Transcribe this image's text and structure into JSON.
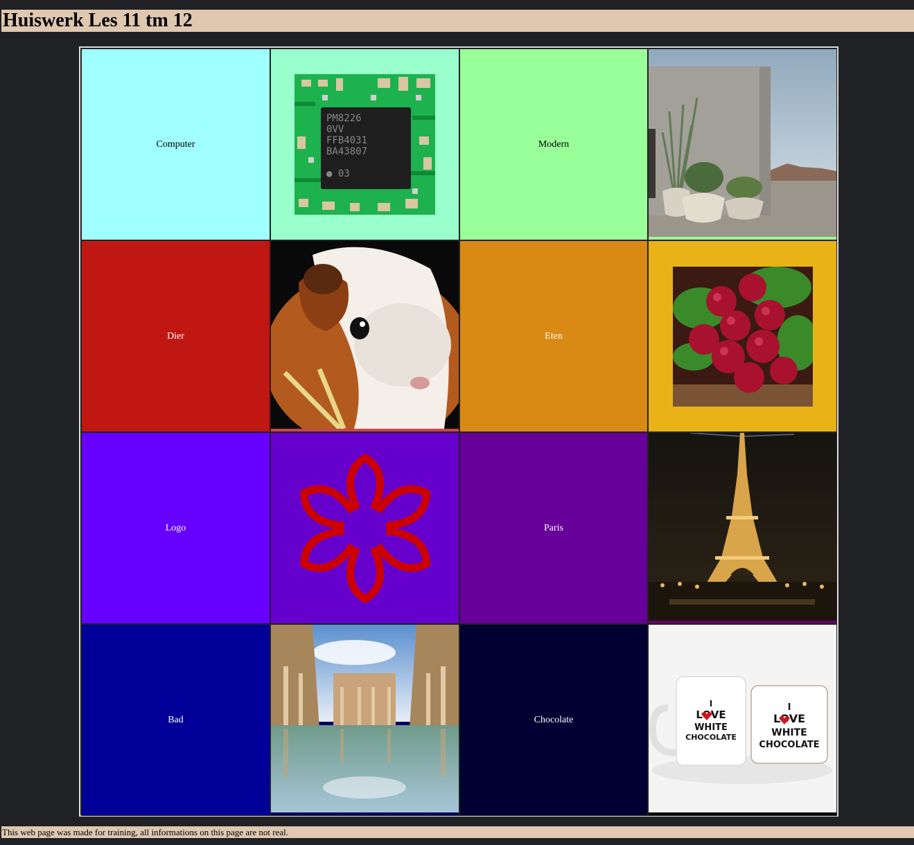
{
  "page_title": "Huiswerk Les 11 tm 12",
  "footer_text": "This web page was made for training, all informations on this page are not real.",
  "rows": [
    {
      "label": "Computer",
      "label_bg": "#a0ffff",
      "label_color": "#000000",
      "image_name": "circuit-chip-image",
      "image_cell_bg": "#99ffcc",
      "chip_text": [
        "PM8226",
        "0VV",
        "FFB4031",
        "BA43807",
        "● 03"
      ],
      "label2": "Modern",
      "label2_bg": "#99ff99",
      "label2_color": "#000000",
      "image2_name": "modern-building-plants-image",
      "image2_cell_bg": "#99ff99"
    },
    {
      "label": "Dier",
      "label_bg": "#c11713",
      "label_color": "#ffffff",
      "image_name": "guinea-pig-image",
      "image_cell_bg": "#c9474a",
      "label2": "Eten",
      "label2_bg": "#d98a15",
      "label2_color": "#ffffff",
      "image2_name": "radishes-image",
      "image2_cell_bg": "#e9b317"
    },
    {
      "label": "Logo",
      "label_bg": "#6600ff",
      "label_color": "#ffffff",
      "image_name": "flower-logo-image",
      "image_cell_bg": "#6600cc",
      "label2": "Paris",
      "label2_bg": "#660099",
      "label2_color": "#ffffff",
      "image2_name": "eiffel-tower-night-image",
      "image2_cell_bg": "#660066"
    },
    {
      "label": "Bad",
      "label_bg": "#000099",
      "label_color": "#ffffff",
      "image_name": "roman-baths-image",
      "image_cell_bg": "#000066",
      "label2": "Chocolate",
      "label2_bg": "#000033",
      "label2_color": "#ffffff",
      "image2_name": "white-chocolate-mugs-image",
      "image2_cell_bg": "#000000",
      "mug_text": [
        "I",
        "LOVE",
        "WHITE",
        "CHOCOLATE"
      ]
    }
  ]
}
